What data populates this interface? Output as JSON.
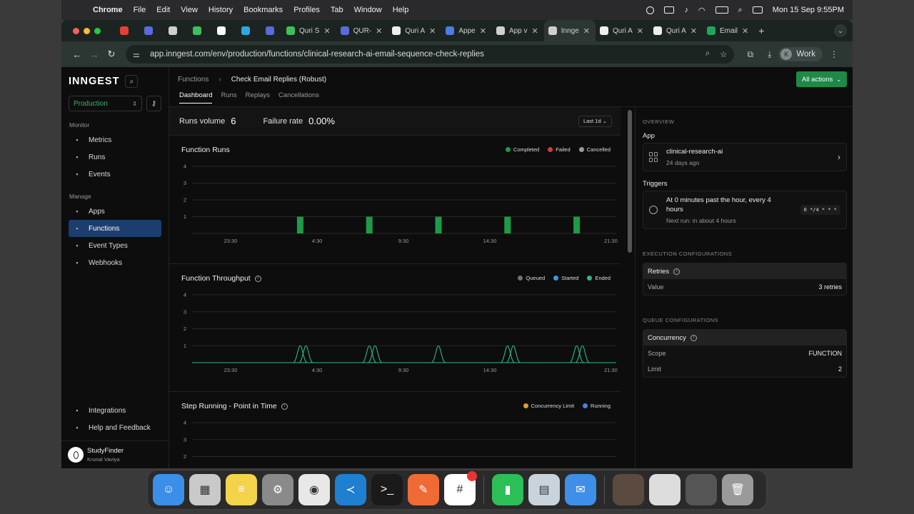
{
  "menubar": {
    "app": "Chrome",
    "items": [
      "File",
      "Edit",
      "View",
      "History",
      "Bookmarks",
      "Profiles",
      "Tab",
      "Window",
      "Help"
    ],
    "clock": "Mon 15 Sep  9:55PM"
  },
  "browser": {
    "tabs": [
      {
        "label": "",
        "color": "#e44134",
        "pinned": true
      },
      {
        "label": "",
        "color": "#5b6bd9",
        "pinned": true
      },
      {
        "label": "",
        "color": "#cfcfcf",
        "pinned": true
      },
      {
        "label": "",
        "color": "#3fbf5b",
        "pinned": true
      },
      {
        "label": "",
        "color": "#ffffff",
        "pinned": true
      },
      {
        "label": "",
        "color": "#2ea8e0",
        "pinned": true
      },
      {
        "label": "",
        "color": "#5b6bd9",
        "pinned": true
      },
      {
        "label": "Quri S",
        "color": "#3fbf5b"
      },
      {
        "label": "QUR-",
        "color": "#5b6bd9"
      },
      {
        "label": "Quri A",
        "color": "#eeeeee"
      },
      {
        "label": "Appe",
        "color": "#4a7fe0"
      },
      {
        "label": "App v",
        "color": "#d0d0d0"
      },
      {
        "label": "Innge",
        "color": "#cfcfcf",
        "active": true
      },
      {
        "label": "Quri A",
        "color": "#eeeeee"
      },
      {
        "label": "Quri A",
        "color": "#eeeeee"
      },
      {
        "label": "Email",
        "color": "#22a55a"
      }
    ],
    "url": "app.inngest.com/env/production/functions/clinical-research-ai-email-sequence-check-replies",
    "profile_initial": "K",
    "profile_name": "Work"
  },
  "sidebar": {
    "logo": "INNGEST",
    "environment": "Production",
    "monitor_label": "Monitor",
    "monitor_items": [
      {
        "label": "Metrics",
        "icon": "chart-line-icon"
      },
      {
        "label": "Runs",
        "icon": "list-icon"
      },
      {
        "label": "Events",
        "icon": "events-icon"
      }
    ],
    "manage_label": "Manage",
    "manage_items": [
      {
        "label": "Apps",
        "icon": "apps-icon"
      },
      {
        "label": "Functions",
        "icon": "functions-icon",
        "active": true
      },
      {
        "label": "Event Types",
        "icon": "event-types-icon"
      },
      {
        "label": "Webhooks",
        "icon": "webhooks-icon"
      }
    ],
    "bottom_items": [
      {
        "label": "Integrations",
        "icon": "integrations-icon"
      },
      {
        "label": "Help and Feedback",
        "icon": "help-icon"
      }
    ],
    "user_name": "StudyFinder",
    "user_sub": "Krunal Vaviya"
  },
  "header": {
    "breadcrumb_root": "Functions",
    "breadcrumb_current": "Check Email Replies (Robust)",
    "tabs": [
      "Dashboard",
      "Runs",
      "Replays",
      "Cancellations"
    ],
    "all_actions": "All actions"
  },
  "stats": {
    "runs_volume_label": "Runs volume",
    "runs_volume": "6",
    "failure_rate_label": "Failure rate",
    "failure_rate": "0.00%",
    "range": "Last 1d"
  },
  "charts": {
    "runs_title": "Function Runs",
    "throughput_title": "Function Throughput",
    "step_title": "Step Running - Point in Time"
  },
  "colors": {
    "completed": "#1f9a49",
    "failed": "#d63a3a",
    "cancelled": "#9a9a9a",
    "queued": "#6b7280",
    "started": "#3b9be0",
    "ended": "#2fb886",
    "concurrency_limit": "#e0a02e",
    "running": "#4f7be8"
  },
  "chart_data": [
    {
      "type": "bar",
      "title": "Function Runs",
      "ylim": [
        0,
        4
      ],
      "yticks": [
        1,
        2,
        3,
        4
      ],
      "xticks": [
        "23:30",
        "4:30",
        "9:30",
        "14:30",
        "21:30"
      ],
      "x": [
        "01:30",
        "05:30",
        "09:30",
        "13:30",
        "17:30",
        "21:30"
      ],
      "series": [
        {
          "name": "Completed",
          "values": [
            1,
            1,
            1,
            1,
            1,
            1
          ]
        },
        {
          "name": "Failed",
          "values": [
            0,
            0,
            0,
            0,
            0,
            0
          ]
        },
        {
          "name": "Cancelled",
          "values": [
            0,
            0,
            0,
            0,
            0,
            0
          ]
        }
      ]
    },
    {
      "type": "line",
      "title": "Function Throughput",
      "ylim": [
        0,
        4
      ],
      "yticks": [
        1,
        2,
        3,
        4
      ],
      "xticks": [
        "23:30",
        "4:30",
        "9:30",
        "14:30",
        "21:30"
      ],
      "series": [
        {
          "name": "Queued",
          "values": []
        },
        {
          "name": "Started",
          "values": []
        },
        {
          "name": "Ended",
          "peaks": [
            "01:30",
            "01:50",
            "05:30",
            "05:50",
            "09:30",
            "13:30",
            "13:50",
            "17:30",
            "17:50",
            "21:30",
            "21:50"
          ],
          "peak_value": 1
        }
      ]
    },
    {
      "type": "line",
      "title": "Step Running - Point in Time",
      "ylim": [
        0,
        4
      ],
      "yticks": [
        1,
        2,
        3,
        4
      ],
      "series": [
        {
          "name": "Concurrency Limit",
          "values": []
        },
        {
          "name": "Running",
          "values": []
        }
      ]
    }
  ],
  "overview": {
    "section": "OVERVIEW",
    "app_label": "App",
    "app_name": "clinical-research-ai",
    "app_age": "24 days ago",
    "triggers_label": "Triggers",
    "trigger_desc": "At 0 minutes past the hour, every 4 hours",
    "trigger_next": "Next run: in about 4 hours",
    "cron": "0 */4 * * *",
    "exec_section": "EXECUTION CONFIGURATIONS",
    "retries_label": "Retries",
    "value_label": "Value",
    "retries_value": "3 retries",
    "queue_section": "QUEUE CONFIGURATIONS",
    "concurrency_label": "Concurrency",
    "scope_label": "Scope",
    "scope_value": "FUNCTION",
    "limit_label": "Limit",
    "limit_value": "2"
  },
  "dock": {
    "apps": [
      {
        "name": "finder-icon",
        "color": "#3b8fe8",
        "glyph": "☺"
      },
      {
        "name": "launchpad-icon",
        "color": "#c9c9c9",
        "glyph": "▦"
      },
      {
        "name": "notes-icon",
        "color": "#f3d34a",
        "glyph": "≡"
      },
      {
        "name": "system-settings-icon",
        "color": "#8a8a8a",
        "glyph": "⚙"
      },
      {
        "name": "chrome-icon",
        "color": "#e8e8e8",
        "glyph": "◉"
      },
      {
        "name": "vscode-icon",
        "color": "#1f7fd1",
        "glyph": "≺"
      },
      {
        "name": "terminal-icon",
        "color": "#1a1a1a",
        "glyph": ">_"
      },
      {
        "name": "postman-icon",
        "color": "#f06a35",
        "glyph": "✎"
      },
      {
        "name": "slack-icon",
        "color": "#ffffff",
        "glyph": "#",
        "badge": true
      }
    ],
    "apps2": [
      {
        "name": "numbers-icon",
        "color": "#2dbf57",
        "glyph": "▮"
      },
      {
        "name": "preview-icon",
        "color": "#c8d3dc",
        "glyph": "▤"
      },
      {
        "name": "mail-icon",
        "color": "#3d8fe8",
        "glyph": "✉"
      }
    ],
    "recent": [
      {
        "name": "recent-window-1-icon",
        "color": "#5a4a40",
        "glyph": ""
      },
      {
        "name": "recent-window-2-icon",
        "color": "#dddddd",
        "glyph": ""
      },
      {
        "name": "recent-window-3-icon",
        "color": "#555555",
        "glyph": ""
      },
      {
        "name": "trash-icon",
        "color": "#9a9a9a",
        "glyph": "🗑"
      }
    ]
  }
}
